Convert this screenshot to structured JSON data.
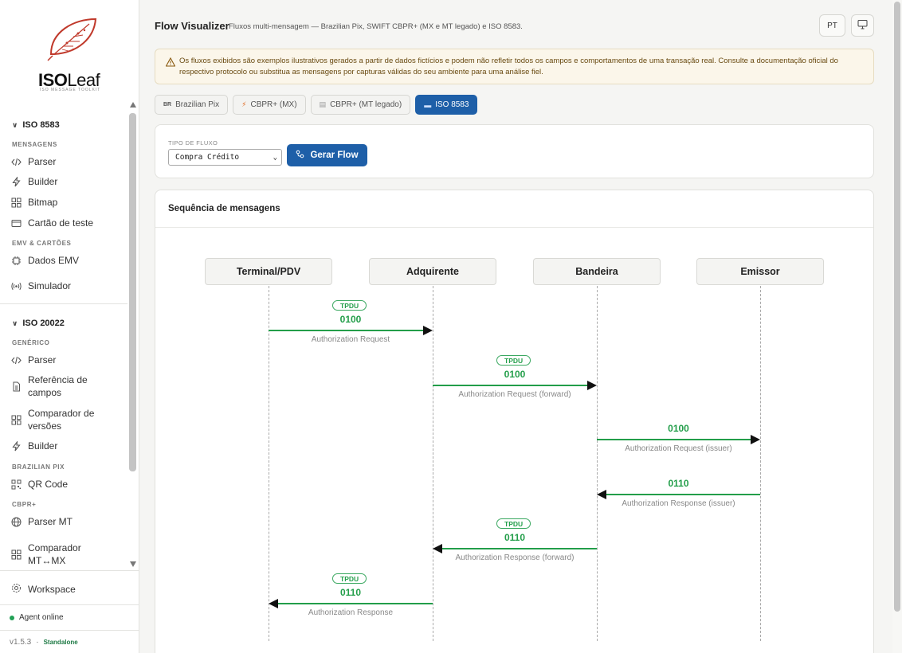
{
  "brand": {
    "name_bold": "ISO",
    "name_light": "Leaf",
    "tagline": "ISO MESSAGE TOOLKIT"
  },
  "sidebar": {
    "iso8583": {
      "title": "ISO 8583",
      "group_messages": "MENSAGENS",
      "items": [
        {
          "label": "Parser",
          "icon": "code-icon"
        },
        {
          "label": "Builder",
          "icon": "bolt-icon"
        },
        {
          "label": "Bitmap",
          "icon": "grid-icon"
        },
        {
          "label": "Cartão de teste",
          "icon": "card-icon"
        }
      ],
      "group_emv": "EMV & CARTÕES",
      "emv_items": [
        {
          "label": "Dados EMV",
          "icon": "chip-icon"
        },
        {
          "label": "Simulador",
          "icon": "broadcast-icon"
        }
      ]
    },
    "iso20022": {
      "title": "ISO 20022",
      "group_generic": "GENÉRICO",
      "items": [
        {
          "label": "Parser",
          "icon": "code-icon"
        },
        {
          "label": "Referência de campos",
          "icon": "document-icon"
        },
        {
          "label": "Comparador de versões",
          "icon": "grid-icon"
        },
        {
          "label": "Builder",
          "icon": "bolt-icon"
        }
      ],
      "group_pix": "BRAZILIAN PIX",
      "pix_items": [
        {
          "label": "QR Code",
          "icon": "qr-icon"
        }
      ],
      "group_cbpr": "CBPR+",
      "cbpr_items": [
        {
          "label": "Parser MT",
          "icon": "globe-icon"
        },
        {
          "label": "Comparador MT↔MX",
          "icon": "grid-icon"
        }
      ]
    },
    "workspace": "Workspace",
    "agent_status": "Agent online",
    "version": "v1.5.3",
    "separator": "·",
    "mode": "Standalone"
  },
  "header": {
    "title": "Flow Visualizer",
    "subtitle": "Fluxos multi-mensagem — Brazilian Pix, SWIFT CBPR+ (MX e MT legado) e ISO 8583.",
    "lang_button": "PT"
  },
  "warning": "Os fluxos exibidos são exemplos ilustrativos gerados a partir de dados fictícios e podem não refletir todos os campos e comportamentos de uma transação real. Consulte a documentação oficial do respectivo protocolo ou substitua as mensagens por capturas válidas do seu ambiente para uma análise fiel.",
  "tabs": [
    {
      "prefix": "BR",
      "label": "Brazilian Pix",
      "active": false
    },
    {
      "prefix": "⚡",
      "label": "CBPR+ (MX)",
      "active": false
    },
    {
      "prefix": "▤",
      "label": "CBPR+ (MT legado)",
      "active": false
    },
    {
      "prefix": "▬",
      "label": "ISO 8583",
      "active": true
    }
  ],
  "flow_form": {
    "label": "TIPO DE FLUXO",
    "selected": "Compra Crédito",
    "button": "Gerar Flow"
  },
  "sequence": {
    "title": "Sequência de mensagens",
    "actors": [
      "Terminal/PDV",
      "Adquirente",
      "Bandeira",
      "Emissor"
    ],
    "messages": [
      {
        "tag": "TPDU",
        "code": "0100",
        "label": "Authorization Request",
        "from": 0,
        "to": 1
      },
      {
        "tag": "TPDU",
        "code": "0100",
        "label": "Authorization Request (forward)",
        "from": 1,
        "to": 2
      },
      {
        "tag": "",
        "code": "0100",
        "label": "Authorization Request (issuer)",
        "from": 2,
        "to": 3
      },
      {
        "tag": "",
        "code": "0110",
        "label": "Authorization Response (issuer)",
        "from": 3,
        "to": 2
      },
      {
        "tag": "TPDU",
        "code": "0110",
        "label": "Authorization Response (forward)",
        "from": 2,
        "to": 1
      },
      {
        "tag": "TPDU",
        "code": "0110",
        "label": "Authorization Response",
        "from": 1,
        "to": 0
      }
    ]
  },
  "colors": {
    "accent": "#1e5fa8",
    "success": "#239e4a",
    "brand_red": "#c0392b"
  }
}
